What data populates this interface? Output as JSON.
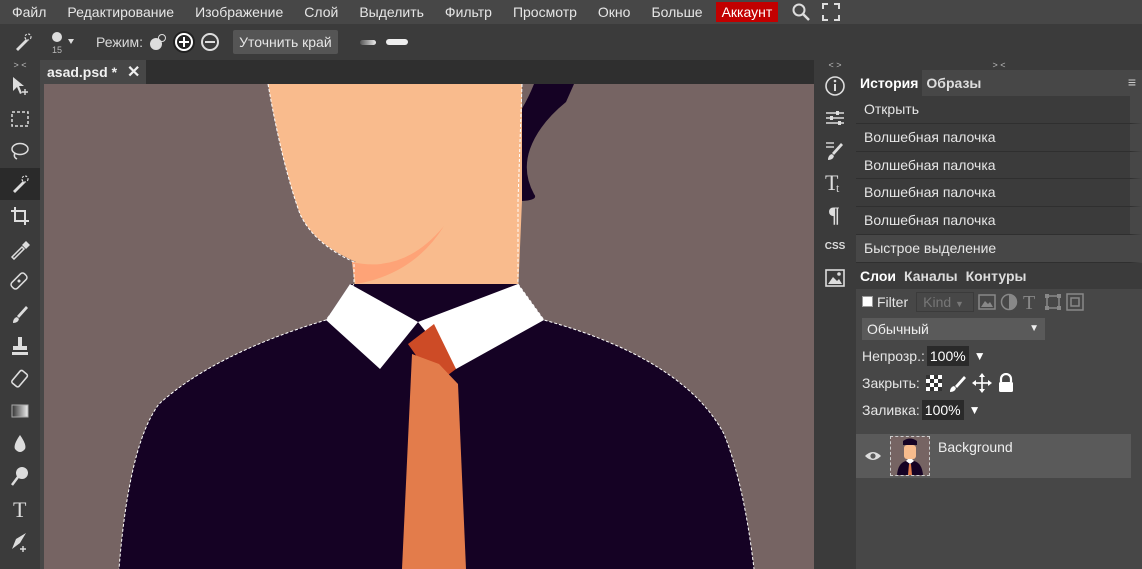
{
  "menu": {
    "items": [
      "Файл",
      "Редактирование",
      "Изображение",
      "Слой",
      "Выделить",
      "Фильтр",
      "Просмотр",
      "Окно",
      "Больше"
    ],
    "account": "Аккаунт",
    "icons": [
      "search-icon",
      "fullscreen-icon"
    ]
  },
  "options": {
    "brush_size": "15",
    "mode_label": "Режим:",
    "refine_edge": "Уточнить край"
  },
  "tools": [
    "move-tool-icon",
    "marquee-tool-icon",
    "lasso-tool-icon",
    "quick-selection-tool-icon",
    "crop-tool-icon",
    "eyedropper-tool-icon",
    "healing-tool-icon",
    "brush-tool-icon",
    "stamp-tool-icon",
    "eraser-tool-icon",
    "gradient-tool-icon",
    "blur-tool-icon",
    "dodge-tool-icon",
    "type-tool-icon",
    "pen-tool-icon"
  ],
  "collapse": {
    "left": "> <",
    "right": "< >",
    "panel": "> <"
  },
  "document": {
    "tab_name": "asad.psd *",
    "close": "✕"
  },
  "right_strip": {
    "css_label": "CSS"
  },
  "history": {
    "tabs": [
      "История",
      "Образы"
    ],
    "menu": "≡",
    "items": [
      "Открыть",
      "Волшебная палочка",
      "Волшебная палочка",
      "Волшебная палочка",
      "Волшебная палочка",
      "Быстрое выделение"
    ]
  },
  "layers": {
    "tabs": [
      "Слои",
      "Каналы",
      "Контуры"
    ],
    "filter_label": "Filter",
    "kind_label": "Kind",
    "blend_mode": "Обычный",
    "opacity_label": "Непрозр.:",
    "opacity_value": "100%",
    "lock_label": "Закрыть:",
    "fill_label": "Заливка:",
    "fill_value": "100%",
    "layer_name": "Background"
  },
  "colors": {
    "background": "#766463",
    "skin": "#f9bb8d",
    "suit": "#150224",
    "tie": "#e37c4b",
    "tie_knot": "#cd4b26",
    "collar": "#ffffff",
    "account": "#c20000"
  }
}
